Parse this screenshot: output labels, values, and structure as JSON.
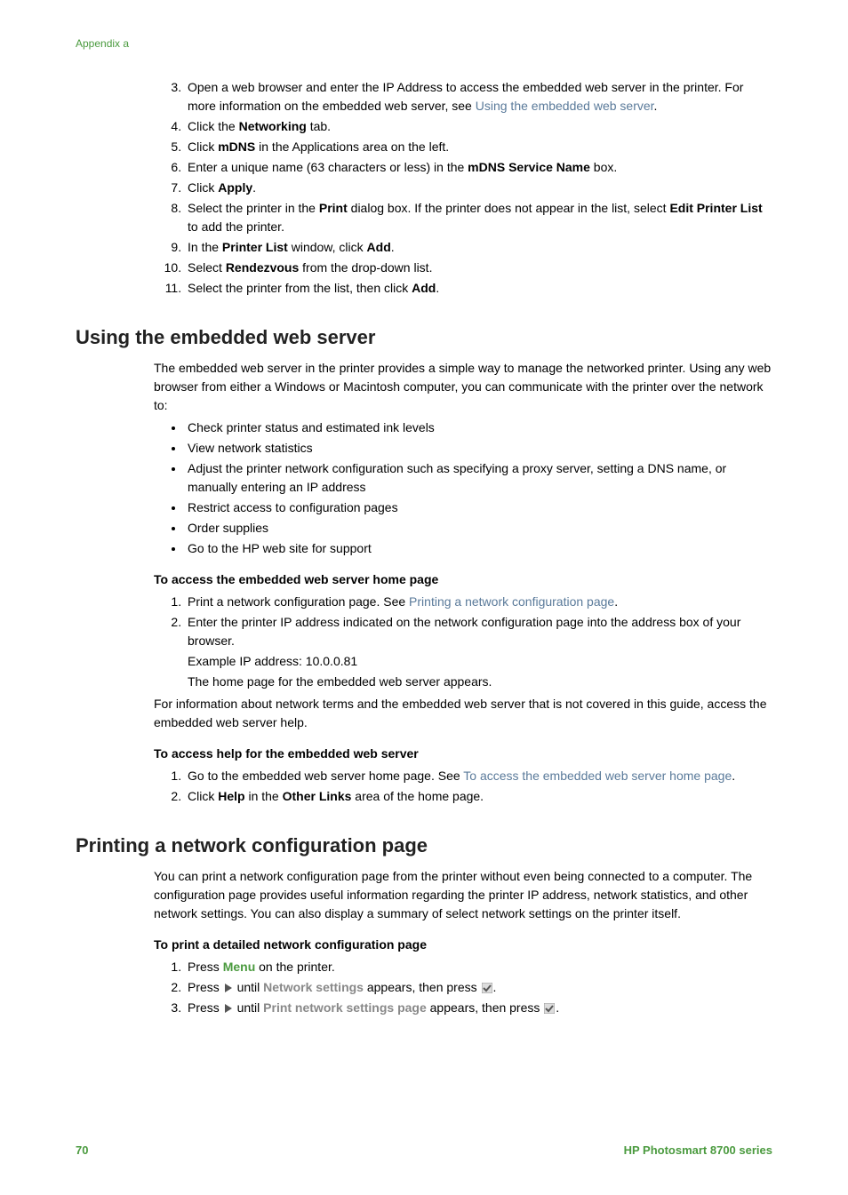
{
  "appendix": "Appendix a",
  "steps_a": {
    "s3_a": "Open a web browser and enter the IP Address to access the embedded web server in the printer. For more information on the embedded web server, see ",
    "s3_link": "Using the embedded web server",
    "s3_b": ".",
    "s4_a": "Click the ",
    "s4_bold": "Networking",
    "s4_b": " tab.",
    "s5_a": "Click ",
    "s5_bold": "mDNS",
    "s5_b": " in the Applications area on the left.",
    "s6_a": "Enter a unique name (63 characters or less) in the ",
    "s6_bold": "mDNS Service Name",
    "s6_b": " box.",
    "s7_a": "Click ",
    "s7_bold": "Apply",
    "s7_b": ".",
    "s8_a": "Select the printer in the ",
    "s8_bold1": "Print",
    "s8_b": " dialog box. If the printer does not appear in the list, select ",
    "s8_bold2": "Edit Printer List",
    "s8_c": " to add the printer.",
    "s9_a": "In the ",
    "s9_bold1": "Printer List",
    "s9_b": " window, click ",
    "s9_bold2": "Add",
    "s9_c": ".",
    "s10_a": "Select ",
    "s10_bold": "Rendezvous",
    "s10_b": " from the drop-down list.",
    "s11_a": "Select the printer from the list, then click ",
    "s11_bold": "Add",
    "s11_b": "."
  },
  "h2_1": "Using the embedded web server",
  "ews_intro": "The embedded web server in the printer provides a simple way to manage the networked printer. Using any web browser from either a Windows or Macintosh computer, you can communicate with the printer over the network to:",
  "ews_bullets": {
    "b1": "Check printer status and estimated ink levels",
    "b2": "View network statistics",
    "b3": "Adjust the printer network configuration such as specifying a proxy server, setting a DNS name, or manually entering an IP address",
    "b4": "Restrict access to configuration pages",
    "b5": "Order supplies",
    "b6": "Go to the HP web site for support"
  },
  "sub1": "To access the embedded web server home page",
  "ews_steps1": {
    "s1_a": "Print a network configuration page. See ",
    "s1_link": "Printing a network configuration page",
    "s1_b": ".",
    "s2": "Enter the printer IP address indicated on the network configuration page into the address box of your browser.",
    "s2_ex": "Example IP address: 10.0.0.81",
    "s2_end": "The home page for the embedded web server appears."
  },
  "ews_info": "For information about network terms and the embedded web server that is not covered in this guide, access the embedded web server help.",
  "sub2": "To access help for the embedded web server",
  "ews_steps2": {
    "s1_a": "Go to the embedded web server home page. See ",
    "s1_link": "To access the embedded web server home page",
    "s1_b": ".",
    "s2_a": "Click ",
    "s2_bold1": "Help",
    "s2_b": " in the ",
    "s2_bold2": "Other Links",
    "s2_c": " area of the home page."
  },
  "h2_2": "Printing a network configuration page",
  "pcfg_intro": "You can print a network configuration page from the printer without even being connected to a computer. The configuration page provides useful information regarding the printer IP address, network statistics, and other network settings. You can also display a summary of select network settings on the printer itself.",
  "sub3": "To print a detailed network configuration page",
  "pcfg_steps": {
    "s1_a": "Press ",
    "s1_menu": "Menu",
    "s1_b": " on the printer.",
    "s2_a": "Press ",
    "s2_b": " until ",
    "s2_gray": "Network settings",
    "s2_c": " appears, then press ",
    "s2_d": ".",
    "s3_a": "Press ",
    "s3_b": " until ",
    "s3_gray": "Print network settings page",
    "s3_c": " appears, then press ",
    "s3_d": "."
  },
  "footer": {
    "page": "70",
    "product": "HP Photosmart 8700 series"
  }
}
